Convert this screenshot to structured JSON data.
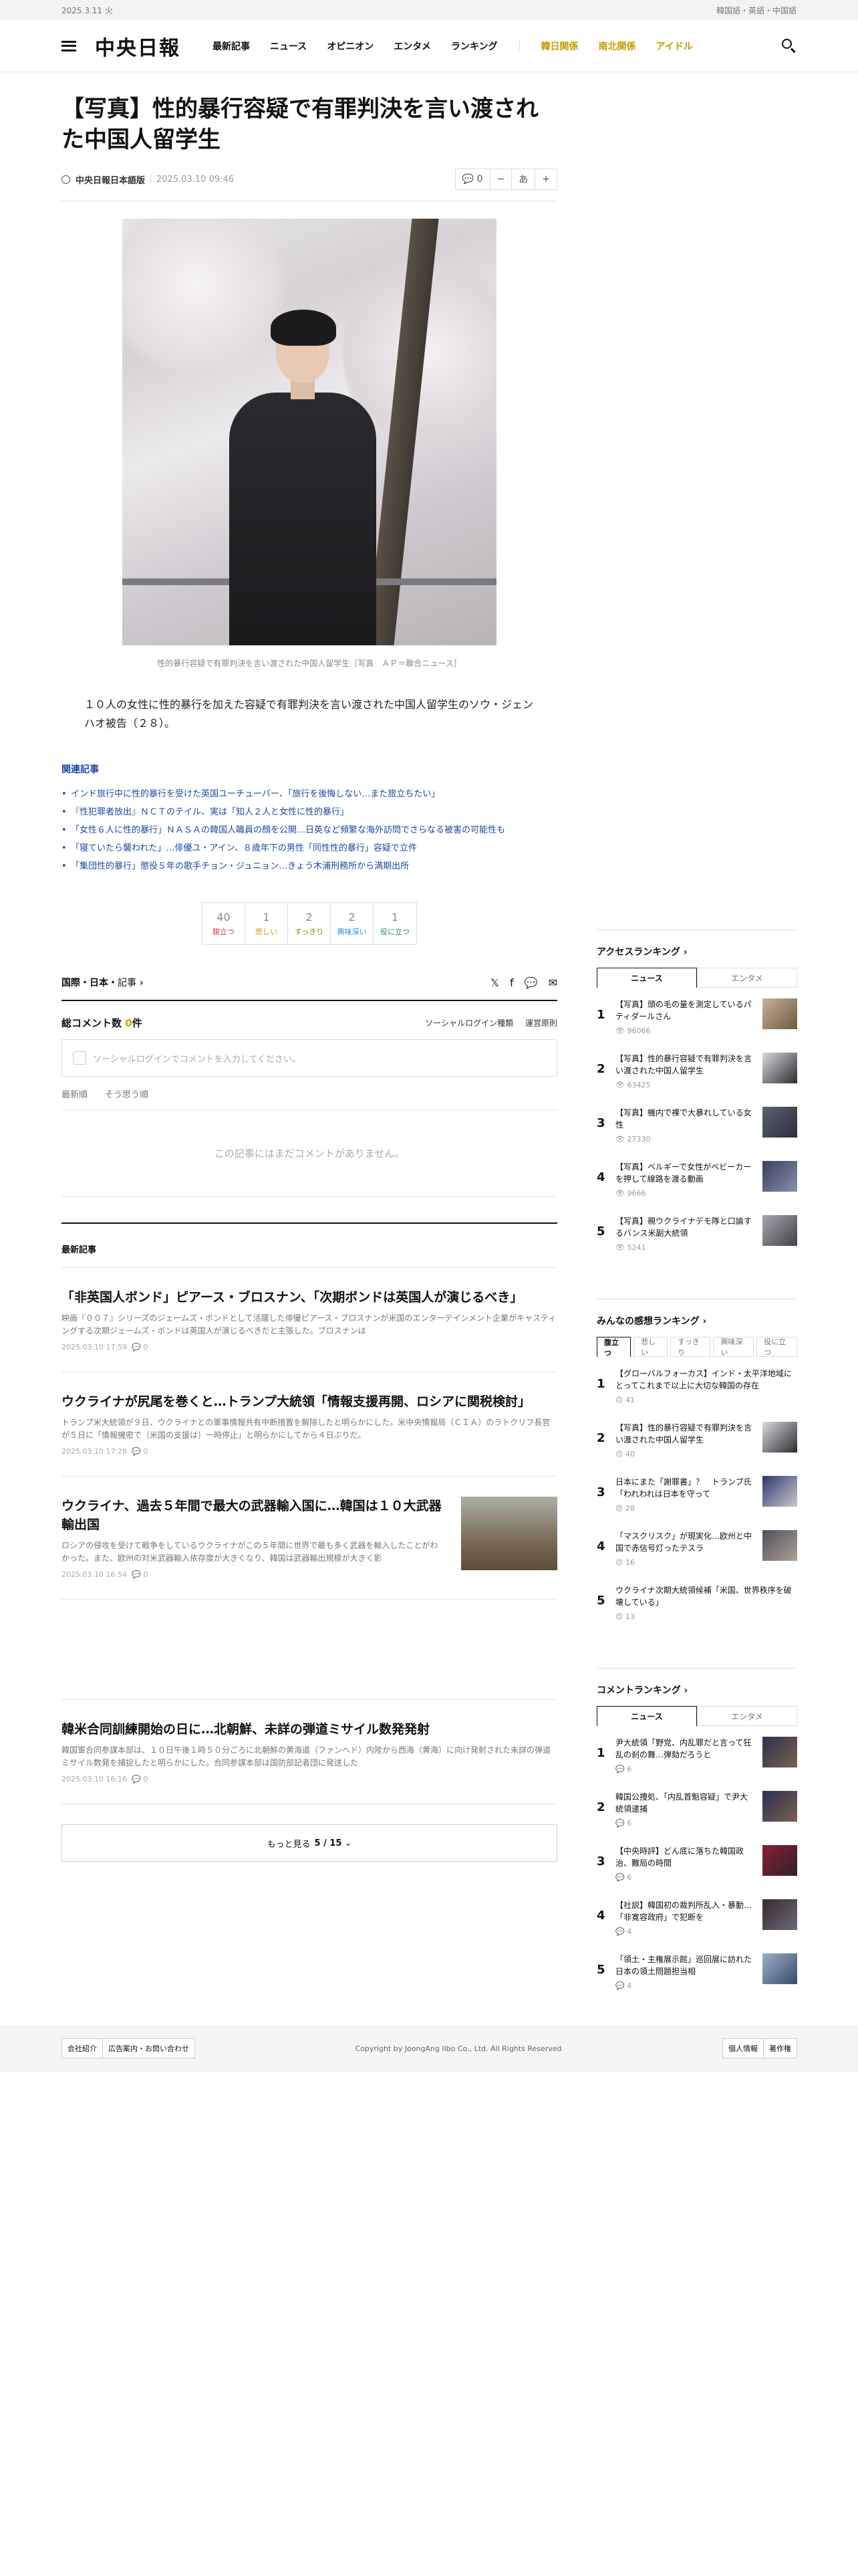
{
  "topbar": {
    "date": "2025.3.11 火",
    "languages": "韓国語・英語・中国語"
  },
  "header": {
    "logo": "中央日報",
    "nav": [
      "最新記事",
      "ニュース",
      "オピニオン",
      "エンタメ",
      "ランキング"
    ],
    "nav_special": [
      "韓日関係",
      "南北関係",
      "アイドル"
    ]
  },
  "article": {
    "title": "【写真】性的暴行容疑で有罪判決を言い渡された中国人留学生",
    "author": "中央日報日本語版",
    "date": "2025.03.10 09:46",
    "comment_count": "0",
    "font_minus": "−",
    "font_label": "あ",
    "font_plus": "+",
    "photo_caption": "性的暴行容疑で有罪判決を言い渡された中国人留学生［写真　ＡＰ＝聯合ニュース］",
    "lead": "１０人の女性に性的暴行を加えた容疑で有罪判決を言い渡された中国人留学生のソウ・ジェンハオ被告（２８）。"
  },
  "related": {
    "title": "関連記事",
    "items": [
      "インド旅行中に性的暴行を受けた英国ユーチューバー、「旅行を後悔しない…また旅立ちたい」",
      "『性犯罪者放出』ＮＣＴのテイル、実は「知人２人と女性に性的暴行」",
      "「女性６人に性的暴行」ＮＡＳＡの韓国人職員の顔を公開…日英など頻繁な海外訪問でさらなる被害の可能性も",
      "「寝ていたら襲われた」…俳優ユ・アイン、８歳年下の男性「同性性的暴行」容疑で立件",
      "「集団性的暴行」懲役５年の歌手チョン・ジュニョン…きょう木浦刑務所から満期出所"
    ]
  },
  "reactions": [
    {
      "count": "40",
      "label": "腹立つ",
      "color": "#d64545"
    },
    {
      "count": "1",
      "label": "悲しい",
      "color": "#c49a00"
    },
    {
      "count": "2",
      "label": "すっきり",
      "color": "#6aa000"
    },
    {
      "count": "2",
      "label": "興味深い",
      "color": "#2d8fd6"
    },
    {
      "count": "1",
      "label": "役に立つ",
      "color": "#2b8a78"
    }
  ],
  "section": {
    "name": "国際・日本",
    "suffix": "記事"
  },
  "share": {
    "x": "𝕏",
    "facebook": "f",
    "chat": "💬",
    "mail": "✉"
  },
  "comments": {
    "total_label": "総コメント数",
    "total": "0",
    "unit": "件",
    "social_login": "ソーシャルログイン種類",
    "rules": "運営原則",
    "placeholder": "ソーシャルログインでコメントを入力してください。",
    "tabs": [
      "最新順",
      "そう思う順"
    ],
    "empty": "この記事にはまだコメントがありません。"
  },
  "latest": {
    "title": "最新記事",
    "articles": [
      {
        "title": "「非英国人ボンド」ピアース・ブロスナン、「次期ボンドは英国人が演じるべき」",
        "summary": "映画『００７』シリーズのジェームズ・ボンドとして活躍した俳優ピアース・ブロスナンが米国のエンターテインメント企業がキャスティングする次期ジェームズ・ボンドは英国人が演じるべきだと主張した。ブロスナンは",
        "date": "2025.03.10 17:59",
        "comments": "0"
      },
      {
        "title": "ウクライナが尻尾を巻くと…トランプ大統領「情報支援再開、ロシアに関税検討」",
        "summary": "トランプ米大統領が９日、ウクライナとの軍事情報共有中断措置を解除したと明らかにした。米中央情報局（ＣＩＡ）のラトクリフ長官が５日に「情報機密で（米国の支援は）一時停止」と明らかにしてから４日ぶりだ。",
        "date": "2025.03.10 17:28",
        "comments": "0"
      },
      {
        "title": "ウクライナ、過去５年間で最大の武器輸入国に…韓国は１０大武器輸出国",
        "summary": "ロシアの侵攻を受けて戦争をしているウクライナがこの５年間に世界で最も多く武器を輸入したことがわかった。また、欧州の対米武器輸入依存度が大きくなり、韓国は武器輸出規模が大きく影",
        "date": "2025.03.10 16:54",
        "comments": "0"
      },
      {
        "title": "韓米合同訓練開始の日に…北朝鮮、未詳の弾道ミサイル数発発射",
        "summary": "韓国軍合同参謀本部は、１０日午後１時５０分ごろに北朝鮮の黄海道（ファンヘド）内陸から西海（黄海）に向け発射された未詳の弾道ミサイル数発を捕捉したと明らかにした。合同参謀本部は国防部記者団に発送した",
        "date": "2025.03.10 16:16",
        "comments": "0"
      }
    ],
    "more_label": "もっと見る",
    "more_page": "5 / 15"
  },
  "access_ranking": {
    "title": "アクセスランキング",
    "tabs": [
      "ニュース",
      "エンタメ"
    ],
    "items": [
      {
        "title": "【写真】頭の毛の量を測定しているパティダールさん",
        "views": "96066"
      },
      {
        "title": "【写真】性的暴行容疑で有罪判決を言い渡された中国人留学生",
        "views": "63425"
      },
      {
        "title": "【写真】機内で裸で大暴れしている女性",
        "views": "27330"
      },
      {
        "title": "【写真】ベルギーで女性がベビーカーを押して線路を渡る動画",
        "views": "9666"
      },
      {
        "title": "【写真】親ウクライナデモ隊と口論するバンス米副大統領",
        "views": "5241"
      }
    ]
  },
  "feeling_ranking": {
    "title": "みんなの感想ランキング",
    "tabs": [
      "腹立つ",
      "悲しい",
      "すっきり",
      "興味深い",
      "役に立つ"
    ],
    "items": [
      {
        "title": "【グローバルフォーカス】インド・太平洋地域にとってこれまで以上に大切な韓国の存在",
        "views": "41"
      },
      {
        "title": "【写真】性的暴行容疑で有罪判決を言い渡された中国人留学生",
        "views": "40"
      },
      {
        "title": "日本にまた「謝罪書」？　トランプ氏「われわれは日本を守って",
        "views": "28"
      },
      {
        "title": "「マスクリスク」が現実化…欧州と中国で赤信号灯ったテスラ",
        "views": "16"
      },
      {
        "title": "ウクライナ次期大統領候補「米国、世界秩序を破壊している」",
        "views": "13"
      }
    ]
  },
  "comment_ranking": {
    "title": "コメントランキング",
    "tabs": [
      "ニュース",
      "エンタメ"
    ],
    "items": [
      {
        "title": "尹大統領「野党、内乱罪だと言って狂乱の刹の舞…弾劾だろうと",
        "views": "6"
      },
      {
        "title": "韓国公捜処、「内乱首魁容疑」で尹大統領逮捕",
        "views": "6"
      },
      {
        "title": "【中央時評】どん底に落ちた韓国政治、難局の時間",
        "views": "6"
      },
      {
        "title": "【社説】韓国初の裁判所乱入・暴動…「非寛容政府」で犯断を",
        "views": "4"
      },
      {
        "title": "「領土・主権展示館」巡回展に訪れた日本の領土問題担当相",
        "views": "4"
      }
    ]
  },
  "footer": {
    "links": [
      "会社紹介",
      "広告案内・お問い合わせ"
    ],
    "copyright": "Copyright by JoongAng Ilbo Co., Ltd. All Rights Reserved",
    "right_links": [
      "個人情報",
      "著作権"
    ]
  }
}
